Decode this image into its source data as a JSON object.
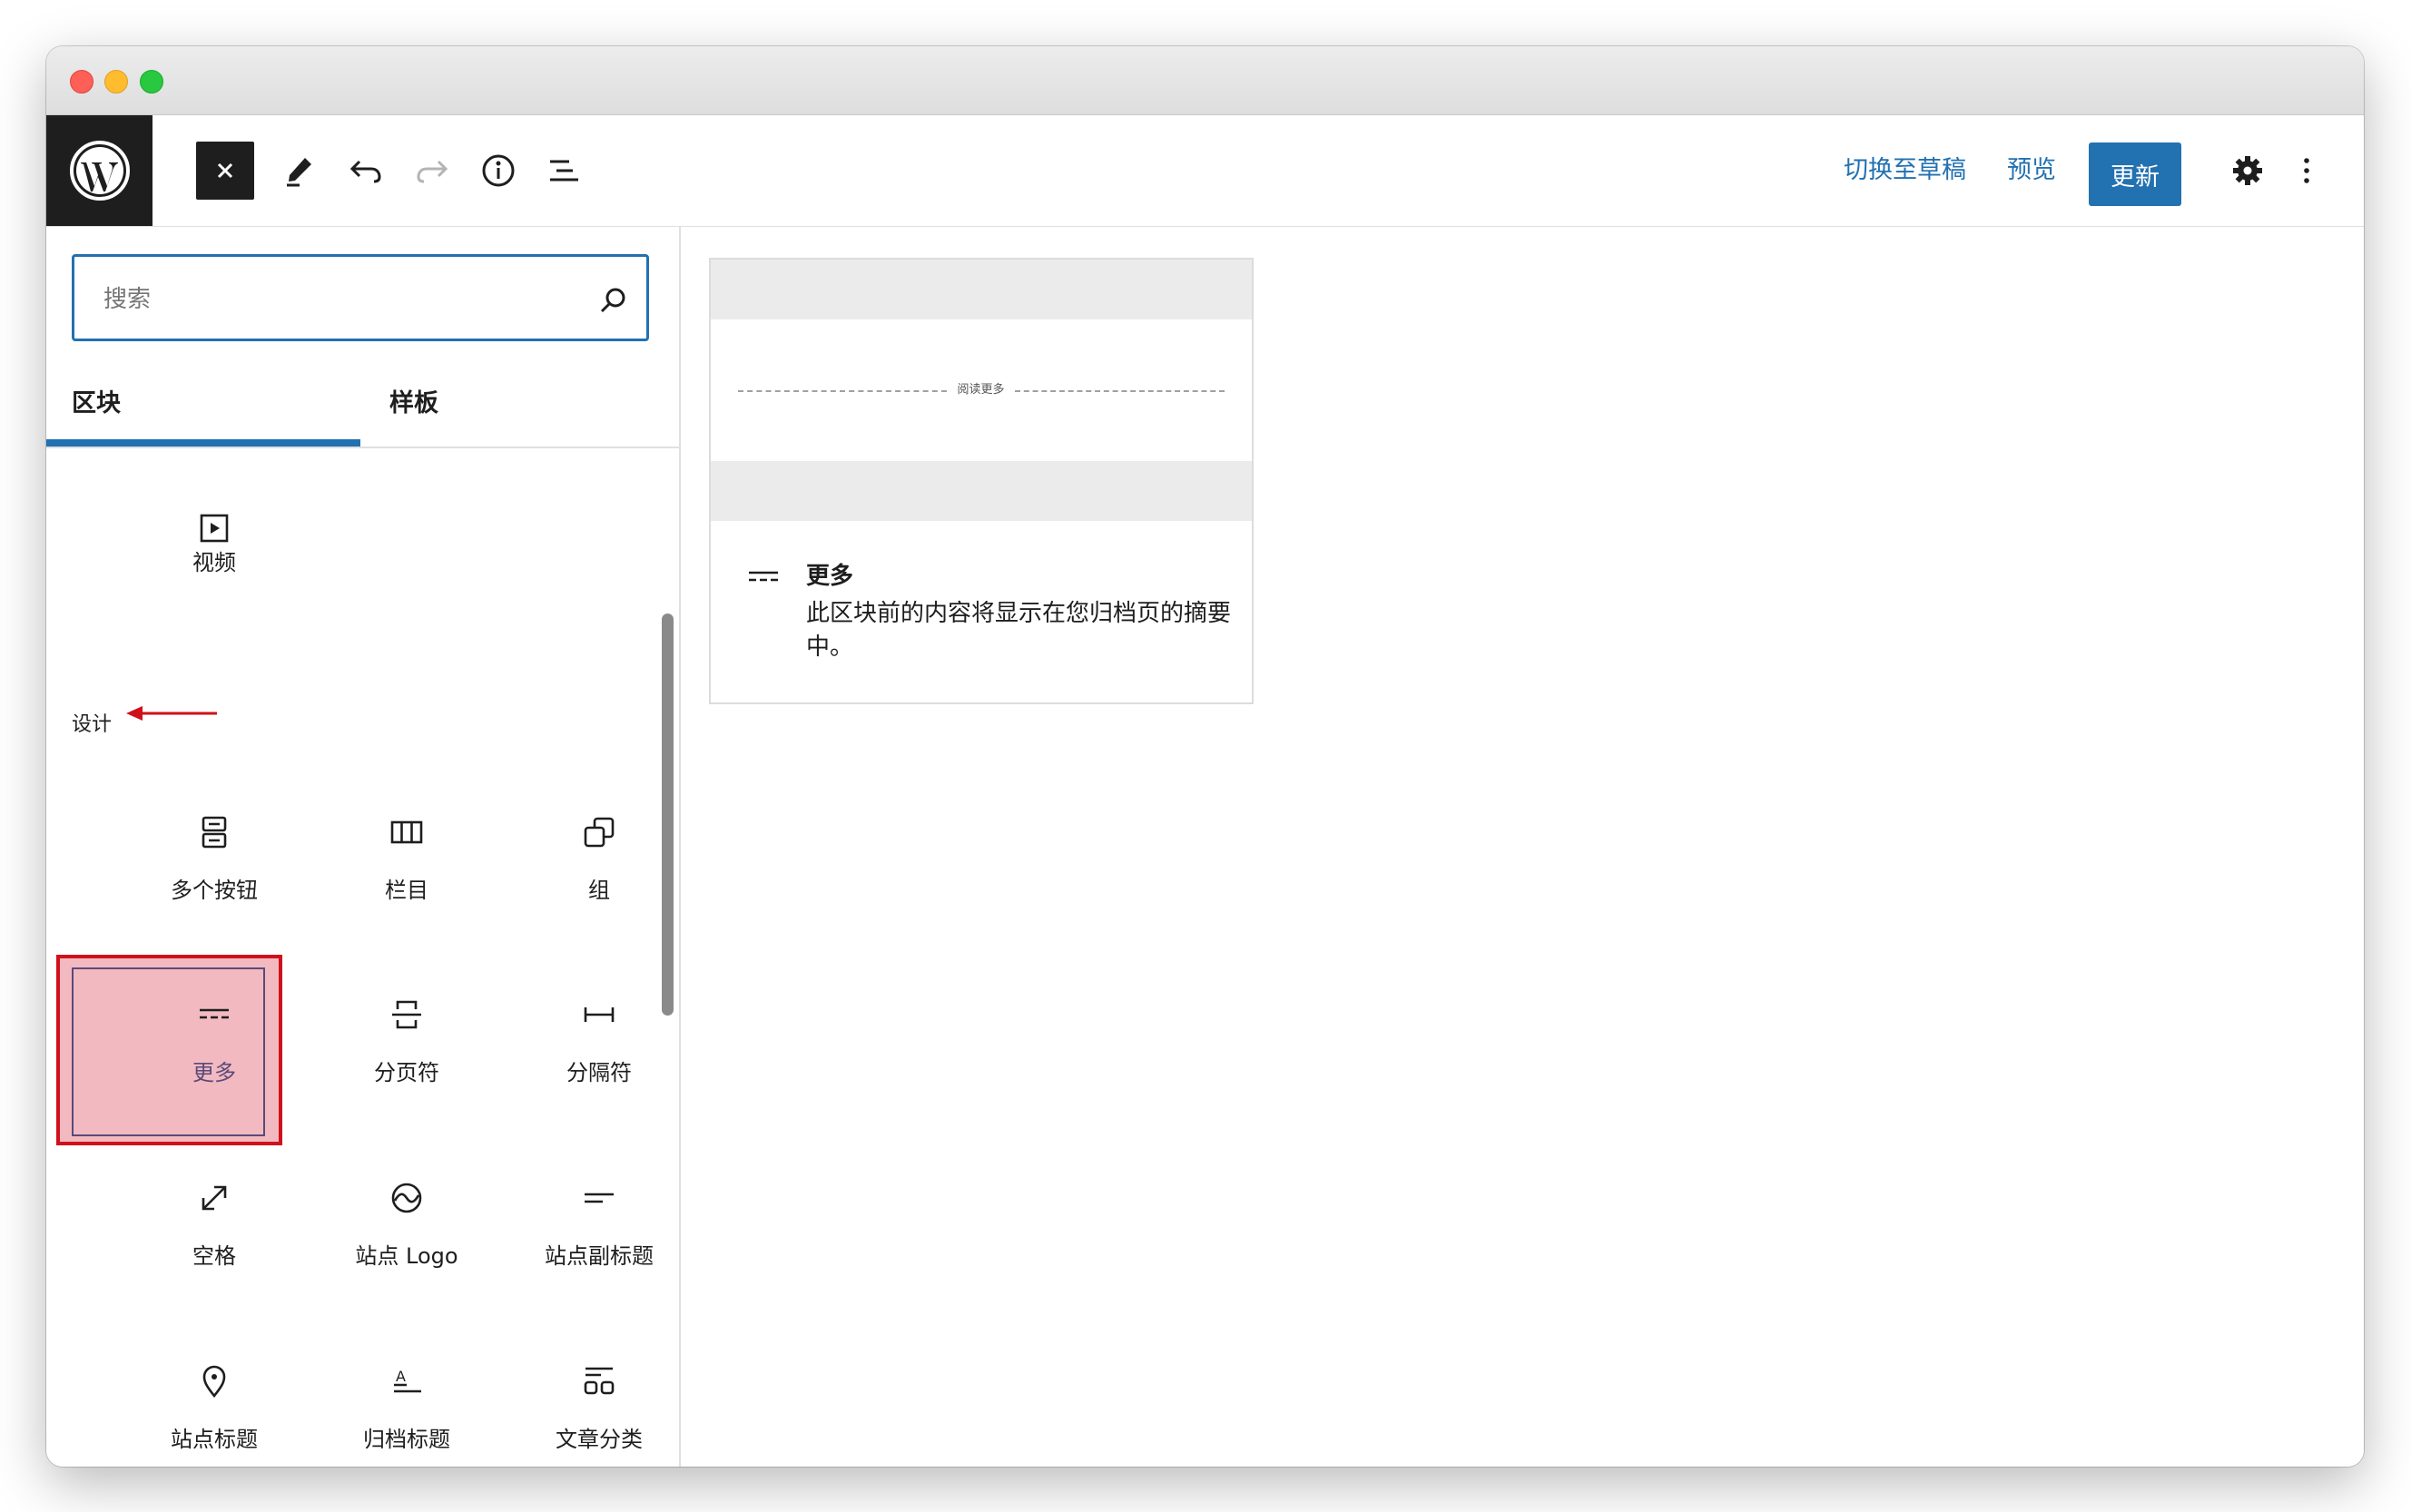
{
  "toolbar": {
    "draft_label": "切换至草稿",
    "preview_label": "预览",
    "update_label": "更新"
  },
  "sidebar": {
    "search": {
      "placeholder": "搜索",
      "value": ""
    },
    "tabs": [
      {
        "label": "区块",
        "active": true
      },
      {
        "label": "样板",
        "active": false
      }
    ],
    "media_items": [
      {
        "label": "视频",
        "icon": "video-icon"
      }
    ],
    "design_heading": "设计",
    "design_items": [
      {
        "label": "多个按钮",
        "icon": "buttons-icon"
      },
      {
        "label": "栏目",
        "icon": "columns-icon"
      },
      {
        "label": "组",
        "icon": "group-icon"
      },
      {
        "label": "更多",
        "icon": "more-icon",
        "selected": true
      },
      {
        "label": "分页符",
        "icon": "page-break-icon"
      },
      {
        "label": "分隔符",
        "icon": "separator-icon"
      },
      {
        "label": "空格",
        "icon": "spacer-icon"
      },
      {
        "label": "站点 Logo",
        "icon": "site-logo-icon"
      },
      {
        "label": "站点副标题",
        "icon": "site-tagline-icon"
      },
      {
        "label": "站点标题",
        "icon": "site-title-icon"
      },
      {
        "label": "归档标题",
        "icon": "archive-title-icon"
      },
      {
        "label": "文章分类",
        "icon": "post-categories-icon"
      }
    ]
  },
  "preview": {
    "read_more_text": "阅读更多",
    "title": "更多",
    "description": "此区块前的内容将显示在您归档页的摘要中。"
  },
  "colors": {
    "accent": "#2271b1",
    "highlight_fill": "#f2b9c0",
    "highlight_border": "#d0101b"
  }
}
